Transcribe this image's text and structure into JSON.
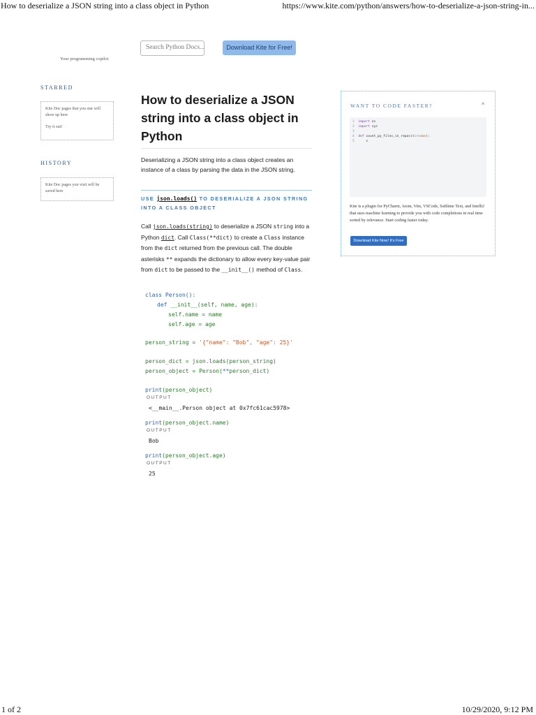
{
  "print_header": {
    "title": "How to deserialize a JSON string into a class object in Python",
    "url": "https://www.kite.com/python/answers/how-to-deserialize-a-json-string-in..."
  },
  "print_footer": {
    "page": "1 of 2",
    "datetime": "10/29/2020, 9:12 PM"
  },
  "header": {
    "tagline": "Your programming copilot",
    "search_placeholder": "Search Python Docs...",
    "download_label": "Download Kite for Free!"
  },
  "sidebar": {
    "starred": {
      "heading": "STARRED",
      "line1": "Kite Doc pages that you star will show up here",
      "line2": "Try it out!"
    },
    "history": {
      "heading": "HISTORY",
      "line1": "Kite Doc pages you visit will be saved here"
    }
  },
  "article": {
    "title": "How to deserialize a JSON string into a class object in Python",
    "intro": "Deserializing a JSON string into a class object creates an instance of a class by parsing the data in the JSON string.",
    "section": {
      "prefix": "USE ",
      "code": "json.loads()",
      "suffix": " TO DESERIALIZE A JSON STRING INTO A CLASS OBJECT"
    },
    "paragraph": {
      "t1": "Call ",
      "c1": "json.loads(string)",
      "t2": " to deserialize a JSON ",
      "c2": "string",
      "t3": " into a Python ",
      "c3": "dict",
      "t4": ". Call ",
      "c4": "Class(**dict)",
      "t5": " to create a ",
      "c5": "Class",
      "t6": " instance from the ",
      "c6": "dict",
      "t7": " returned from the previous call. The double asterisks ",
      "c7": "**",
      "t8": " expands the dictionary to allow every key-value pair from ",
      "c8": "dict",
      "t9": " to be passed to the ",
      "c9": "__init__()",
      "t10": " method of ",
      "c10": "Class",
      "t11": "."
    },
    "code": {
      "class_kw": "class",
      "class_rest": " Person():",
      "def_kw": "def",
      "def_rest": " __init__(self, name, age):",
      "assign_name": "self.name = name",
      "assign_age": "self.age = age",
      "ps_left": "person_string = ",
      "ps_str": "'{\"name\": \"Bob\", \"age\": 25}'",
      "pd_line": "person_dict = json.loads(person_string)",
      "po_left": "person_object = Person(",
      "po_op": "**",
      "po_right": "person_dict)",
      "print_kw": "print",
      "print1_rest": "(person_object)",
      "print2_rest": "(person_object.name)",
      "print3_rest": "(person_object.age)"
    },
    "output_label": "OUTPUT",
    "outputs": [
      "<__main__.Person object at 0x7fc61cac5978>",
      "Bob",
      "25"
    ]
  },
  "promo": {
    "heading": "WANT TO CODE FASTER?",
    "caret": "^",
    "editor": {
      "l1n": "1",
      "l1k": "import",
      "l1r": " os",
      "l2n": "2",
      "l2k": "import",
      "l2r": " sys",
      "l3n": "3",
      "l4n": "4",
      "l4k": "def",
      "l4r": " count_py_files_in_repos(",
      "l4a": "dirname",
      "l4e": "):",
      "l5n": "5",
      "l5r": "    s"
    },
    "text": "Kite is a plugin for PyCharm, Atom, Vim, VSCode, Sublime Text, and IntelliJ that uses machine learning to provide you with code completions in real time sorted by relevance. Start coding faster today.",
    "button_label": "Download Kite Now! It's Free"
  }
}
